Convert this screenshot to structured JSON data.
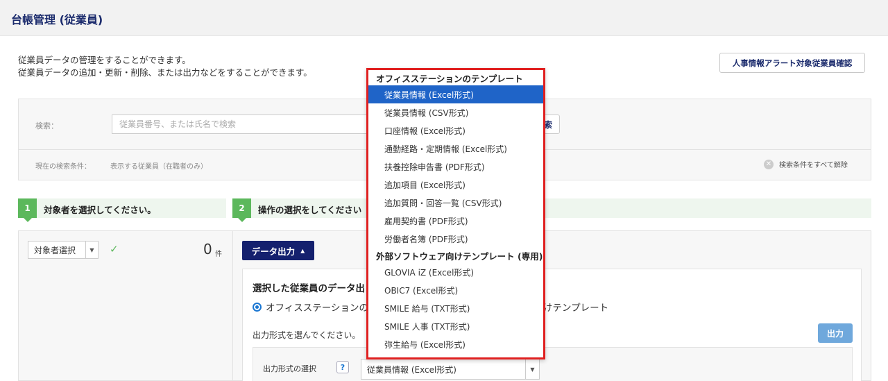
{
  "header": {
    "title": "台帳管理 (従業員)"
  },
  "description": {
    "line1": "従業員データの管理をすることができます。",
    "line2": "従業員データの追加・更新・削除、または出力などをすることができます。"
  },
  "alert_button": "人事情報アラート対象従業員確認",
  "search": {
    "label": "検索：",
    "placeholder": "従業員番号、または氏名で検索",
    "button_partial": "索",
    "condition_label": "現在の検索条件：",
    "condition_value": "表示する従業員（在職者のみ）",
    "clear_label": "検索条件をすべて解除"
  },
  "steps": [
    {
      "num": "1",
      "text": "対象者を選択してください。"
    },
    {
      "num": "2",
      "text": "操作の選択をしてください"
    }
  ],
  "target": {
    "select_label": "対象者選択",
    "count": "0",
    "count_unit": "件"
  },
  "data_output": {
    "button_label": "データ出力",
    "title_partial": "選択した従業員のデータ出",
    "radio_label_partial": "オフィスステーションの",
    "radio_tail_partial": "けテンプレート",
    "format_hint": "出力形式を選んでください。",
    "output_button": "出力",
    "format_label": "出力形式の選択",
    "help": "?",
    "format_selected": "従業員情報 (Excel形式)"
  },
  "dropdown": {
    "group1": "オフィスステーションのテンプレート",
    "items1": [
      "従業員情報 (Excel形式)",
      "従業員情報 (CSV形式)",
      "口座情報 (Excel形式)",
      "通勤経路・定期情報 (Excel形式)",
      "扶養控除申告書 (PDF形式)",
      "追加項目 (Excel形式)",
      "追加質問・回答一覧 (CSV形式)",
      "雇用契約書 (PDF形式)",
      "労働者名簿 (PDF形式)"
    ],
    "group2": "外部ソフトウェア向けテンプレート (専用)",
    "items2": [
      "GLOVIA iZ (Excel形式)",
      "OBIC7 (Excel形式)",
      "SMILE 給与 (TXT形式)",
      "SMILE 人事 (TXT形式)",
      "弥生給与 (Excel形式)"
    ]
  }
}
